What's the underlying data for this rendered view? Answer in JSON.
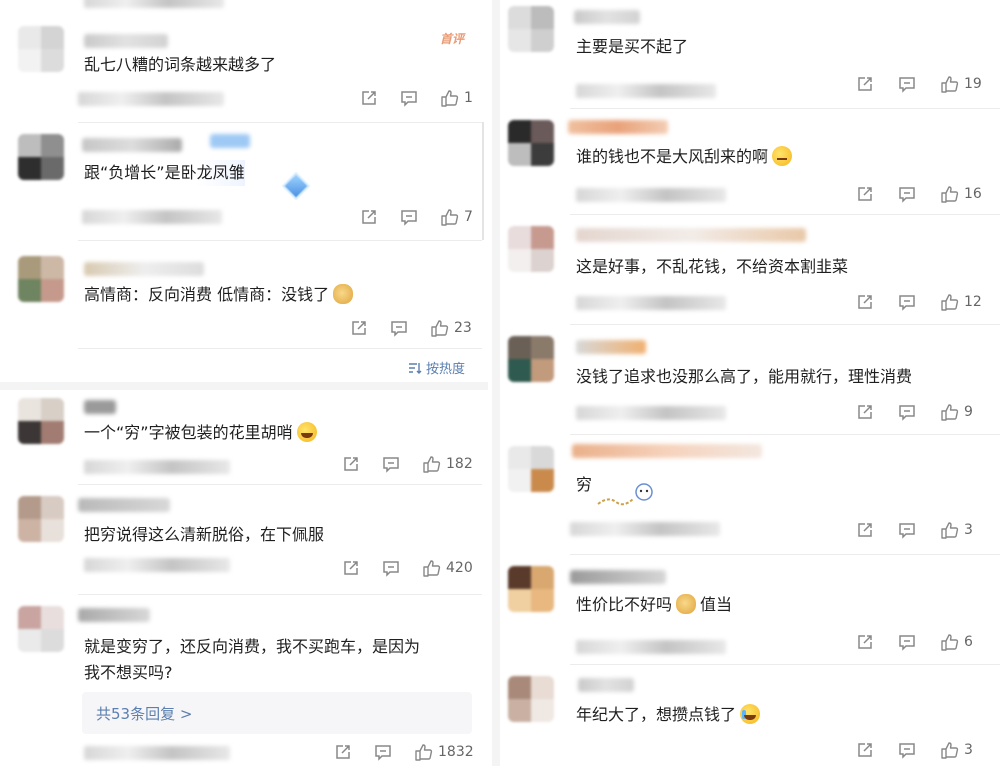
{
  "sort_label": "按热度",
  "hot_tag": "首评",
  "left": [
    {
      "text": "乱七八糟的词条越来越多了",
      "likes": "1",
      "emoji": ""
    },
    {
      "text": "跟“负增长”是卧龙凤雏",
      "likes": "7",
      "emoji": ""
    },
    {
      "text": "高情商：反向消费 低情商：没钱了",
      "likes": "23",
      "emoji": "dog"
    },
    {
      "text": "一个“穷”字被包装的花里胡哨",
      "likes": "182",
      "emoji": "laugh"
    },
    {
      "text": "把穷说得这么清新脱俗，在下佩服",
      "likes": "420",
      "emoji": ""
    },
    {
      "text_line1": "就是变穷了，还反向消费，我不买跑车，是因为",
      "text_line2": "我不想买吗?",
      "likes": "1832",
      "reply_label": "共53条回复 >"
    }
  ],
  "right": [
    {
      "text": "主要是买不起了",
      "likes": "19",
      "emoji": ""
    },
    {
      "text": "谁的钱也不是大风刮来的啊",
      "likes": "16",
      "emoji": "sleepy"
    },
    {
      "text": "这是好事，不乱花钱，不给资本割韭菜",
      "likes": "12",
      "emoji": ""
    },
    {
      "text": "没钱了追求也没那么高了，能用就行，理性消费",
      "likes": "9",
      "emoji": ""
    },
    {
      "text": "穷",
      "likes": "3",
      "emoji": ""
    },
    {
      "text": "性价比不好吗",
      "text_after": "值当",
      "likes": "6",
      "emoji": "dog"
    },
    {
      "text": "年纪大了，想攒点钱了",
      "likes": "3",
      "emoji": "cry"
    }
  ],
  "icons": {
    "share": "share-icon",
    "comment": "comment-icon",
    "like": "like-icon"
  }
}
